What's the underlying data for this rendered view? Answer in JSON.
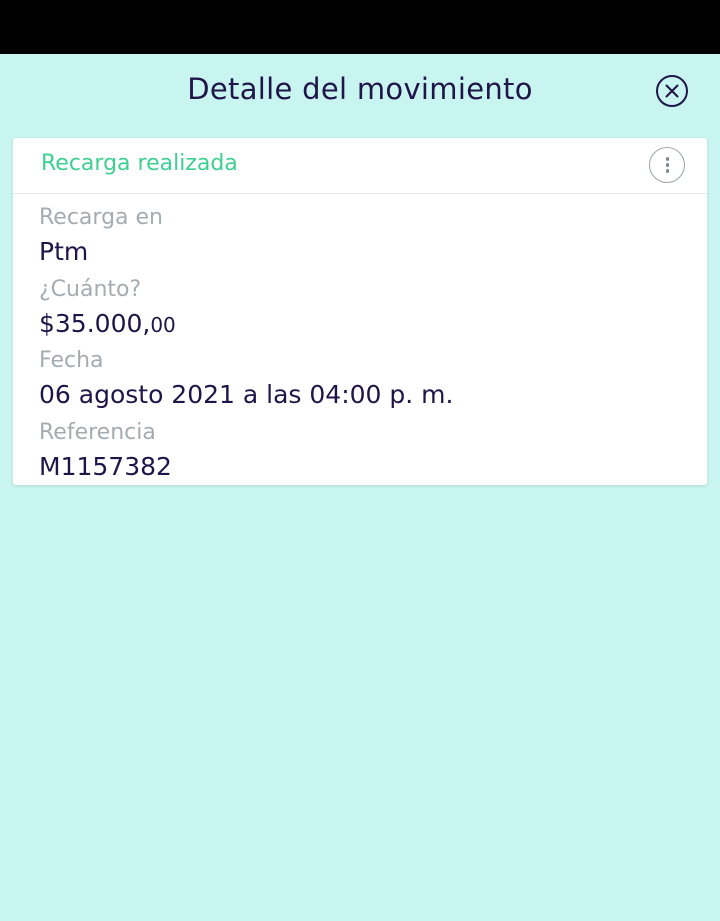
{
  "header": {
    "title": "Detalle del movimiento",
    "close_icon": "close-circle-icon"
  },
  "card": {
    "status": "Recarga realizada",
    "menu_icon": "more-vertical-icon",
    "fields": [
      {
        "label": "Recarga en",
        "value": "Ptm"
      },
      {
        "label": "¿Cuánto?",
        "value_main": "$35.000,",
        "value_cents": "00"
      },
      {
        "label": "Fecha",
        "value": "06 agosto 2021 a las 04:00 p. m."
      },
      {
        "label": "Referencia",
        "value": "M1157382"
      }
    ]
  },
  "colors": {
    "background": "#c9f5f1",
    "title_text": "#1f1548",
    "status_green": "#3fcf92",
    "label_gray": "#a5acb1",
    "status_bar": "#000000"
  }
}
